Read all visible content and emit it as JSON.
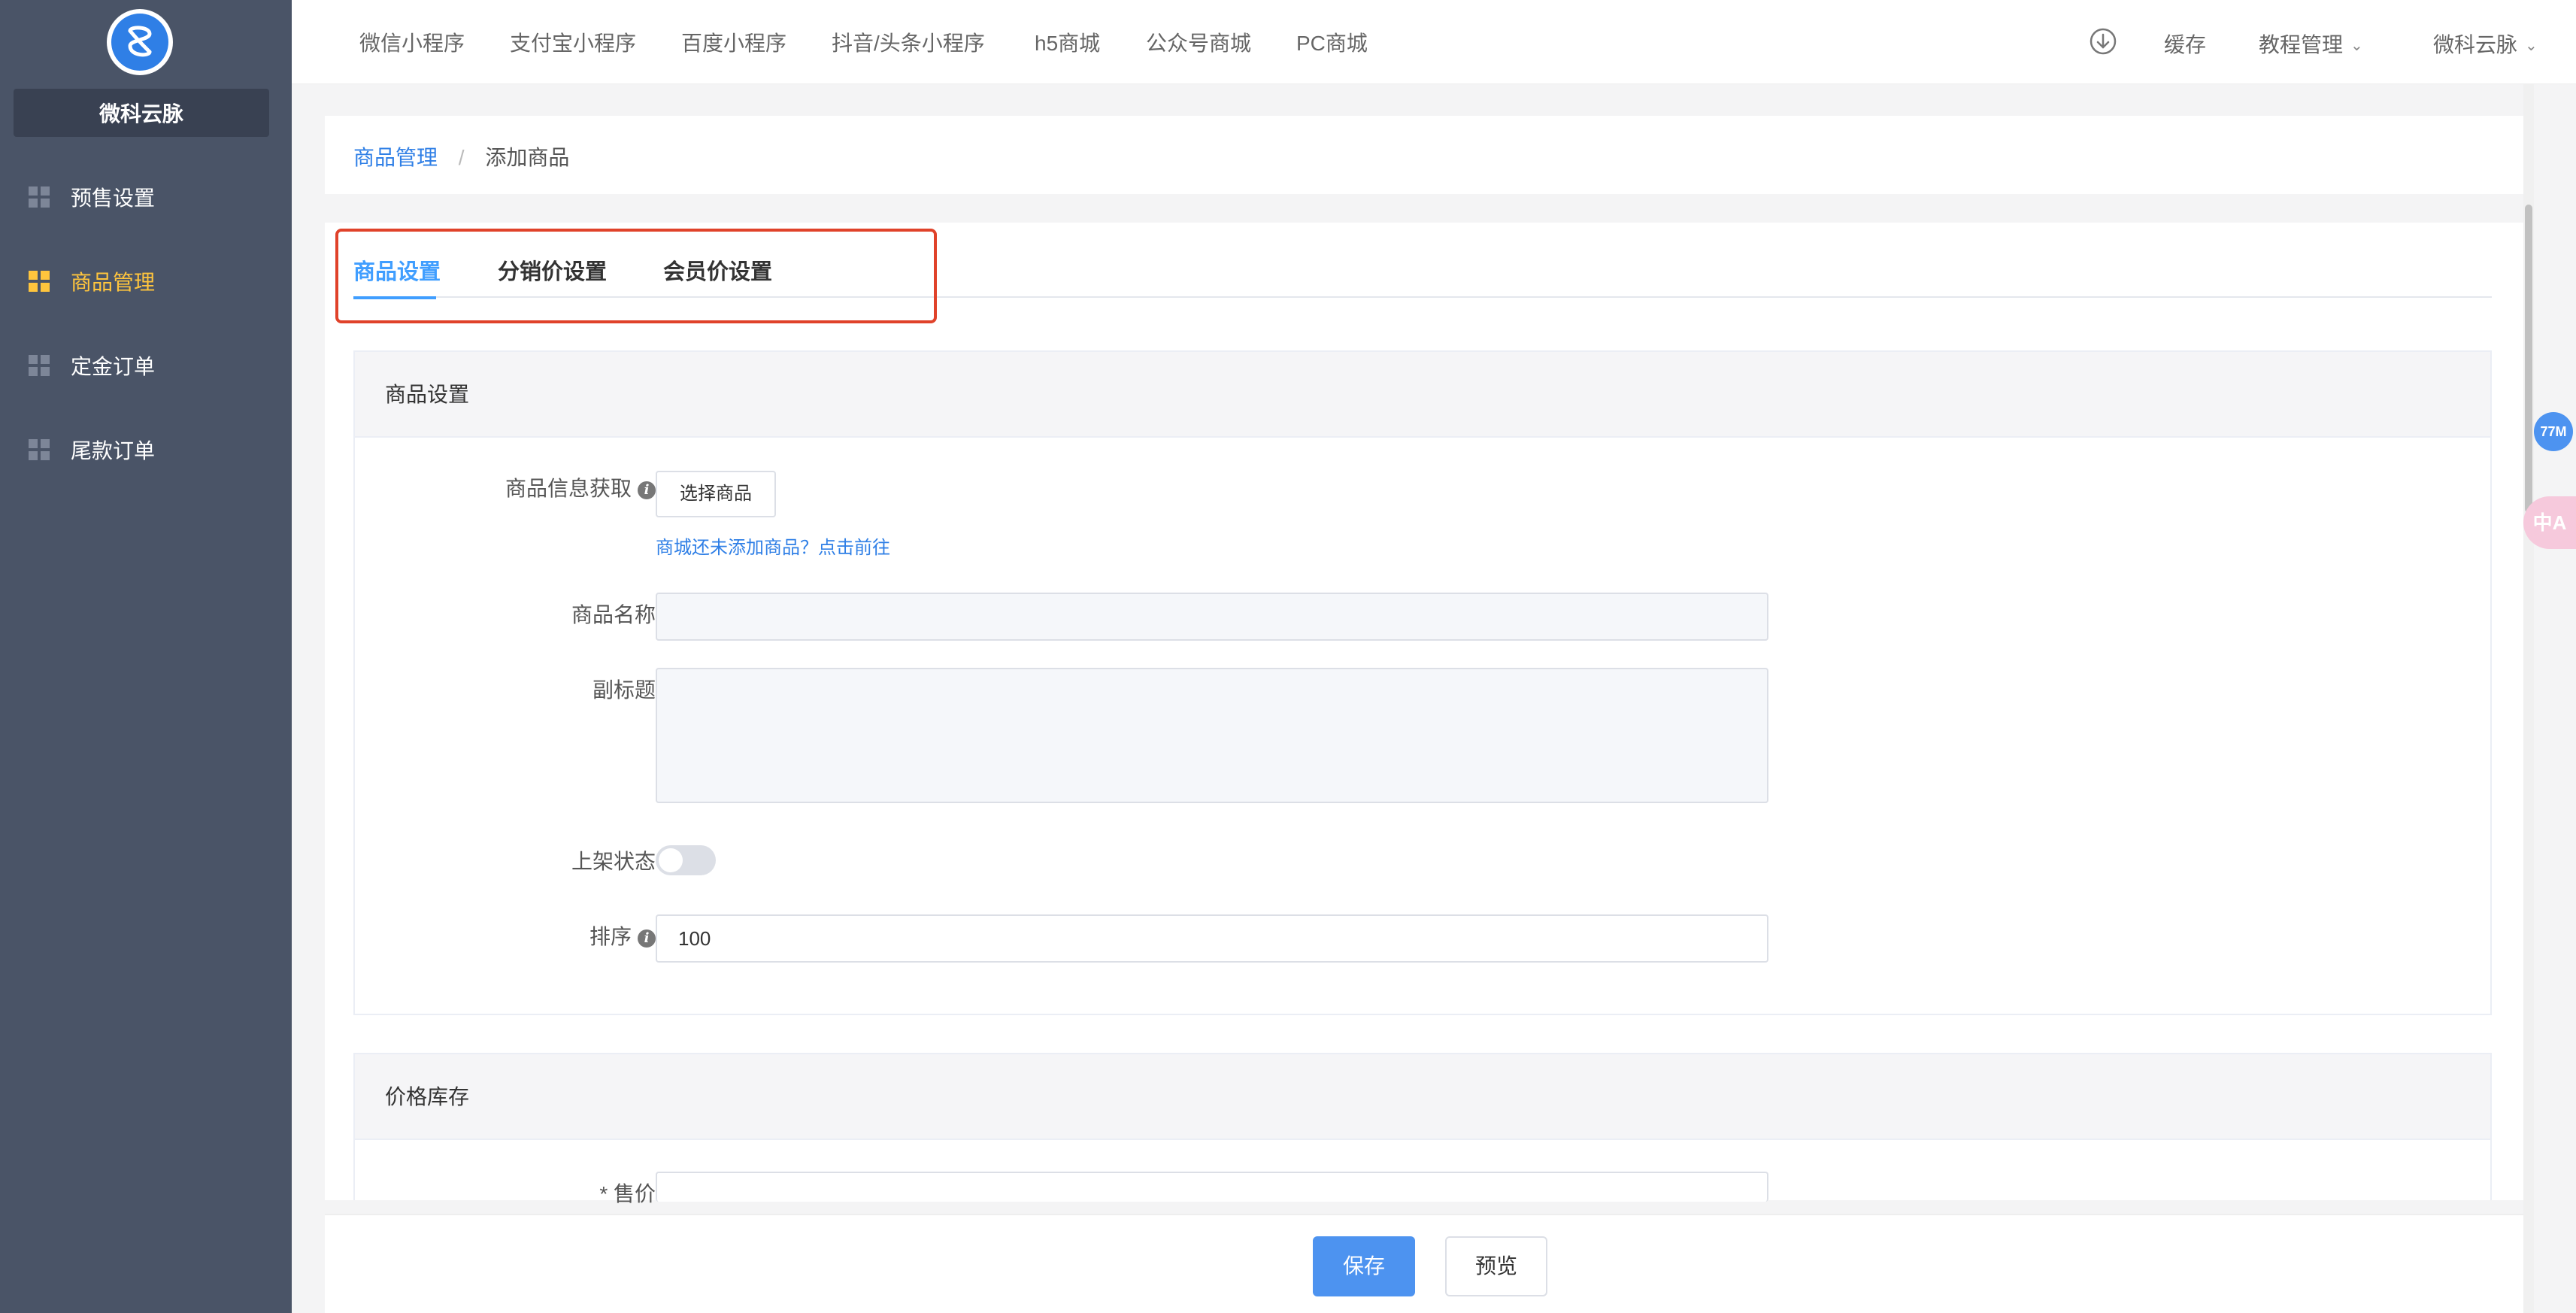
{
  "sidebar": {
    "brand": "微科云脉",
    "items": [
      {
        "label": "预售设置"
      },
      {
        "label": "商品管理"
      },
      {
        "label": "定金订单"
      },
      {
        "label": "尾款订单"
      }
    ]
  },
  "topbar": {
    "nav": [
      "微信小程序",
      "支付宝小程序",
      "百度小程序",
      "抖音/头条小程序",
      "h5商城",
      "公众号商城",
      "PC商城"
    ],
    "cache": "缓存",
    "tutorial": "教程管理",
    "account": "微科云脉"
  },
  "breadcrumb": {
    "parent": "商品管理",
    "separator": "/",
    "current": "添加商品"
  },
  "tabs": [
    "商品设置",
    "分销价设置",
    "会员价设置"
  ],
  "goods_section": {
    "title": "商品设置",
    "fetch_label": "商品信息获取",
    "select_button": "选择商品",
    "hint_link": "商城还未添加商品？点击前往",
    "name_label": "商品名称",
    "name_value": "",
    "subtitle_label": "副标题",
    "subtitle_value": "",
    "status_label": "上架状态",
    "status_on": false,
    "sort_label": "排序",
    "sort_value": "100"
  },
  "price_section": {
    "title": "价格库存",
    "price_label": "* 售价"
  },
  "footer": {
    "save": "保存",
    "preview": "预览"
  },
  "floating": {
    "memory": "77M",
    "translate": "中A"
  },
  "colors": {
    "sidebar_bg": "#4a5467",
    "active_nav": "#ffc53d",
    "accent": "#409eff",
    "highlight_box": "#e0422a"
  }
}
